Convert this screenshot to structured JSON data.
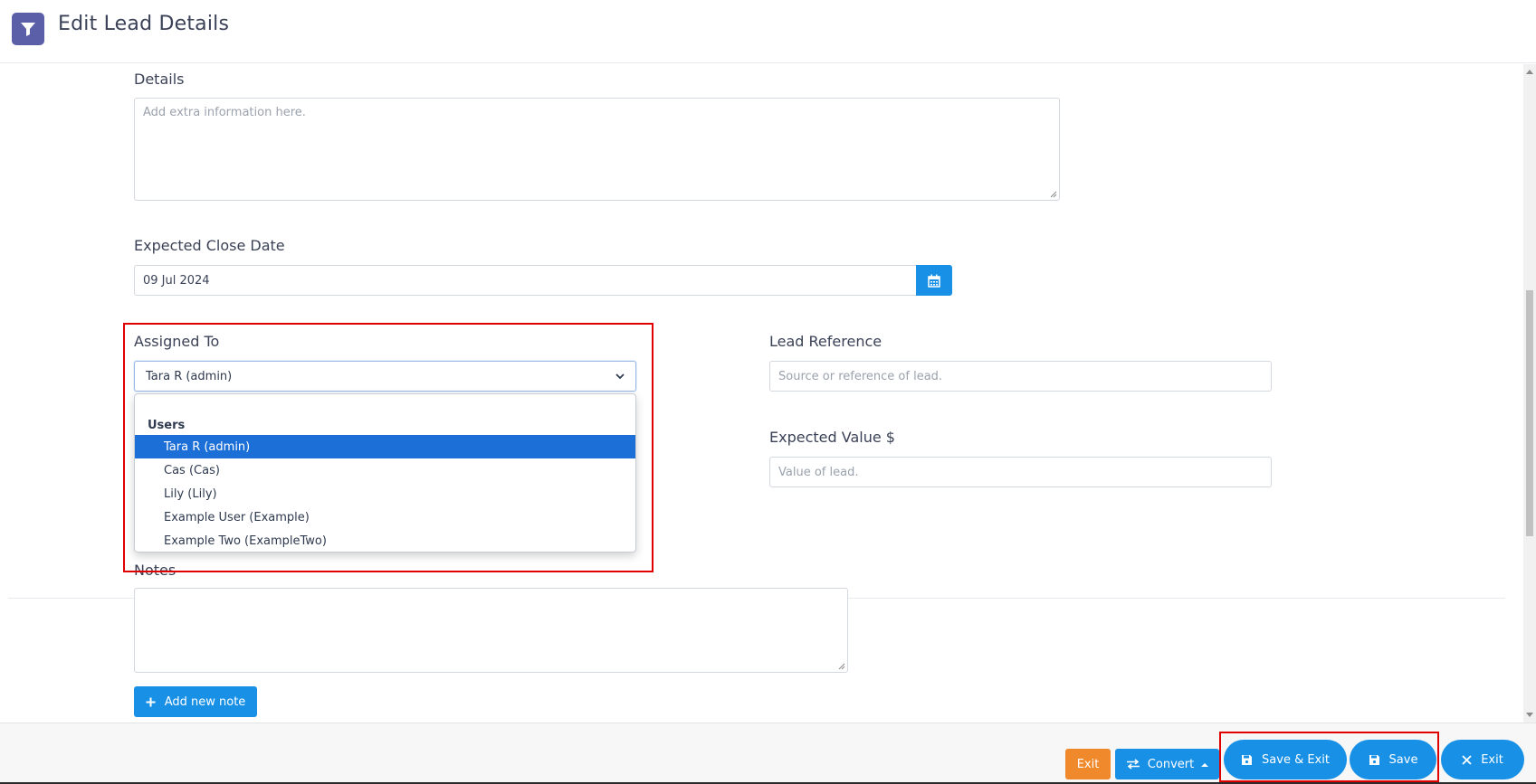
{
  "header": {
    "title": "Edit Lead Details",
    "logo_icon": "funnel-icon",
    "logo_color": "#5b5fa8"
  },
  "form": {
    "details": {
      "label": "Details",
      "placeholder": "Add extra information here.",
      "value": ""
    },
    "expected_close_date": {
      "label": "Expected Close Date",
      "value": "09 Jul 2024",
      "button_icon": "calendar-icon"
    },
    "assigned_to": {
      "label": "Assigned To",
      "value": "Tara R (admin)",
      "dropdown": {
        "group_label": "Users",
        "options": [
          {
            "label": "Tara R (admin)",
            "selected": true
          },
          {
            "label": "Cas (Cas)",
            "selected": false
          },
          {
            "label": "Lily (Lily)",
            "selected": false
          },
          {
            "label": "Example User (Example)",
            "selected": false
          },
          {
            "label": "Example Two (ExampleTwo)",
            "selected": false
          }
        ]
      }
    },
    "lead_reference": {
      "label": "Lead Reference",
      "placeholder": "Source or reference of lead.",
      "value": ""
    },
    "expected_value": {
      "label": "Expected Value $",
      "placeholder": "Value of lead.",
      "value": ""
    },
    "notes": {
      "label": "Notes",
      "value": "",
      "add_note_label": "Add new note"
    }
  },
  "footer": {
    "exit_small_label": "Exit",
    "convert_label": "Convert",
    "save_exit_label": "Save & Exit",
    "save_label": "Save",
    "exit_label": "Exit"
  },
  "colors": {
    "primary": "#1890e6",
    "warning": "#f0892b",
    "selected_option": "#1c6fd6",
    "highlight": "#e10000"
  }
}
